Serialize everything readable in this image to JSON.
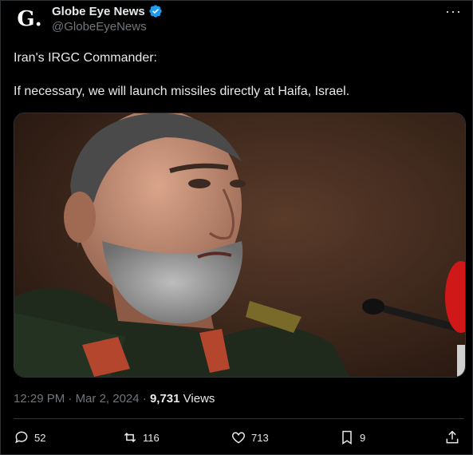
{
  "author": {
    "avatar_letter": "G",
    "avatar_dot": ".",
    "name": "Globe Eye News",
    "handle": "@GlobeEyeNews",
    "verified_color": "#1d9bf0"
  },
  "more_label": "···",
  "tweet": {
    "line1": "Iran's IRGC Commander:",
    "line2": "If necessary, we will launch missiles directly at Haifa, Israel."
  },
  "meta": {
    "time": "12:29 PM",
    "dot1": " · ",
    "date": "Mar 2, 2024",
    "dot2": " · ",
    "views_count": "9,731",
    "views_label": " Views"
  },
  "actions": {
    "replies": "52",
    "reposts": "116",
    "likes": "713",
    "bookmarks": "9"
  },
  "icons": [
    "verified-badge-icon",
    "more-icon",
    "reply-icon",
    "repost-icon",
    "like-icon",
    "bookmark-icon",
    "share-icon"
  ]
}
